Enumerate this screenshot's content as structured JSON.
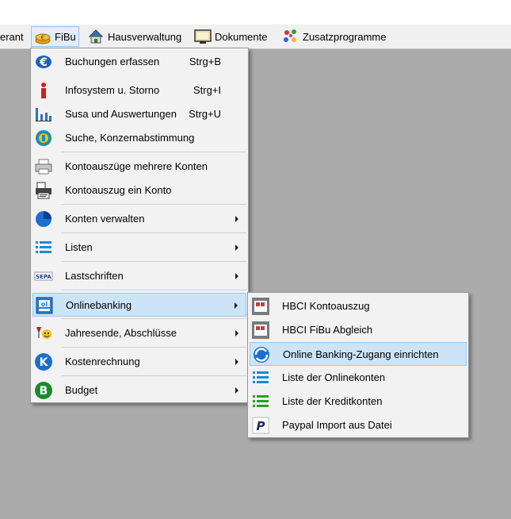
{
  "menubar": {
    "partial_label": "erant",
    "items": [
      {
        "label": "FiBu",
        "icon": "euro-coins-icon"
      },
      {
        "label": "Hausverwaltung",
        "icon": "house-icon"
      },
      {
        "label": "Dokumente",
        "icon": "document-monitor-icon"
      },
      {
        "label": "Zusatzprogramme",
        "icon": "colorful-dots-icon"
      }
    ]
  },
  "fibu_menu": {
    "items": [
      {
        "label": "Buchungen erfassen",
        "shortcut": "Strg+B",
        "icon": "euro-icon"
      },
      {
        "label": "Infosystem u. Storno",
        "shortcut": "Strg+I",
        "icon": "info-icon"
      },
      {
        "label": "Susa und Auswertungen",
        "shortcut": "Strg+U",
        "icon": "bar-chart-icon"
      },
      {
        "label": "Suche, Konzernabstimmung",
        "shortcut": "",
        "icon": "search-globe-icon"
      },
      {
        "label": "Kontoauszüge mehrere Konten",
        "shortcut": "",
        "icon": "printer-icon"
      },
      {
        "label": "Kontoauszug ein Konto",
        "shortcut": "",
        "icon": "printer-sheet-icon"
      },
      {
        "label": "Konten verwalten",
        "shortcut": "",
        "icon": "pie-globe-icon"
      },
      {
        "label": "Listen",
        "shortcut": "",
        "icon": "list-icon"
      },
      {
        "label": "Lastschriften",
        "shortcut": "",
        "icon": "sepa-icon",
        "icon_text": "SEPA"
      },
      {
        "label": "Onlinebanking",
        "shortcut": "",
        "icon": "online-banking-icon"
      },
      {
        "label": "Jahresende, Abschlüsse",
        "shortcut": "",
        "icon": "celebration-icon"
      },
      {
        "label": "Kostenrechnung",
        "shortcut": "",
        "icon": "k-circle-icon",
        "icon_text": "K"
      },
      {
        "label": "Budget",
        "shortcut": "",
        "icon": "budget-circle-icon",
        "icon_text": "B"
      }
    ]
  },
  "onlinebanking_submenu": {
    "items": [
      {
        "label": "HBCI Kontoauszug",
        "icon": "hbci-statement-icon"
      },
      {
        "label": "HBCI FiBu Abgleich",
        "icon": "hbci-reconcile-icon"
      },
      {
        "label": "Online Banking-Zugang einrichten",
        "icon": "sync-globe-icon"
      },
      {
        "label": "Liste der Onlinekonten",
        "icon": "list-blue-icon"
      },
      {
        "label": "Liste der Kreditkonten",
        "icon": "list-green-icon"
      },
      {
        "label": "Paypal Import aus Datei",
        "icon": "paypal-icon",
        "icon_text": "P"
      }
    ]
  },
  "colors": {
    "highlight": "#cce4f7",
    "highlight_border": "#99c9ef",
    "menu_bg": "#f2f2f2",
    "desktop": "#ababab"
  }
}
